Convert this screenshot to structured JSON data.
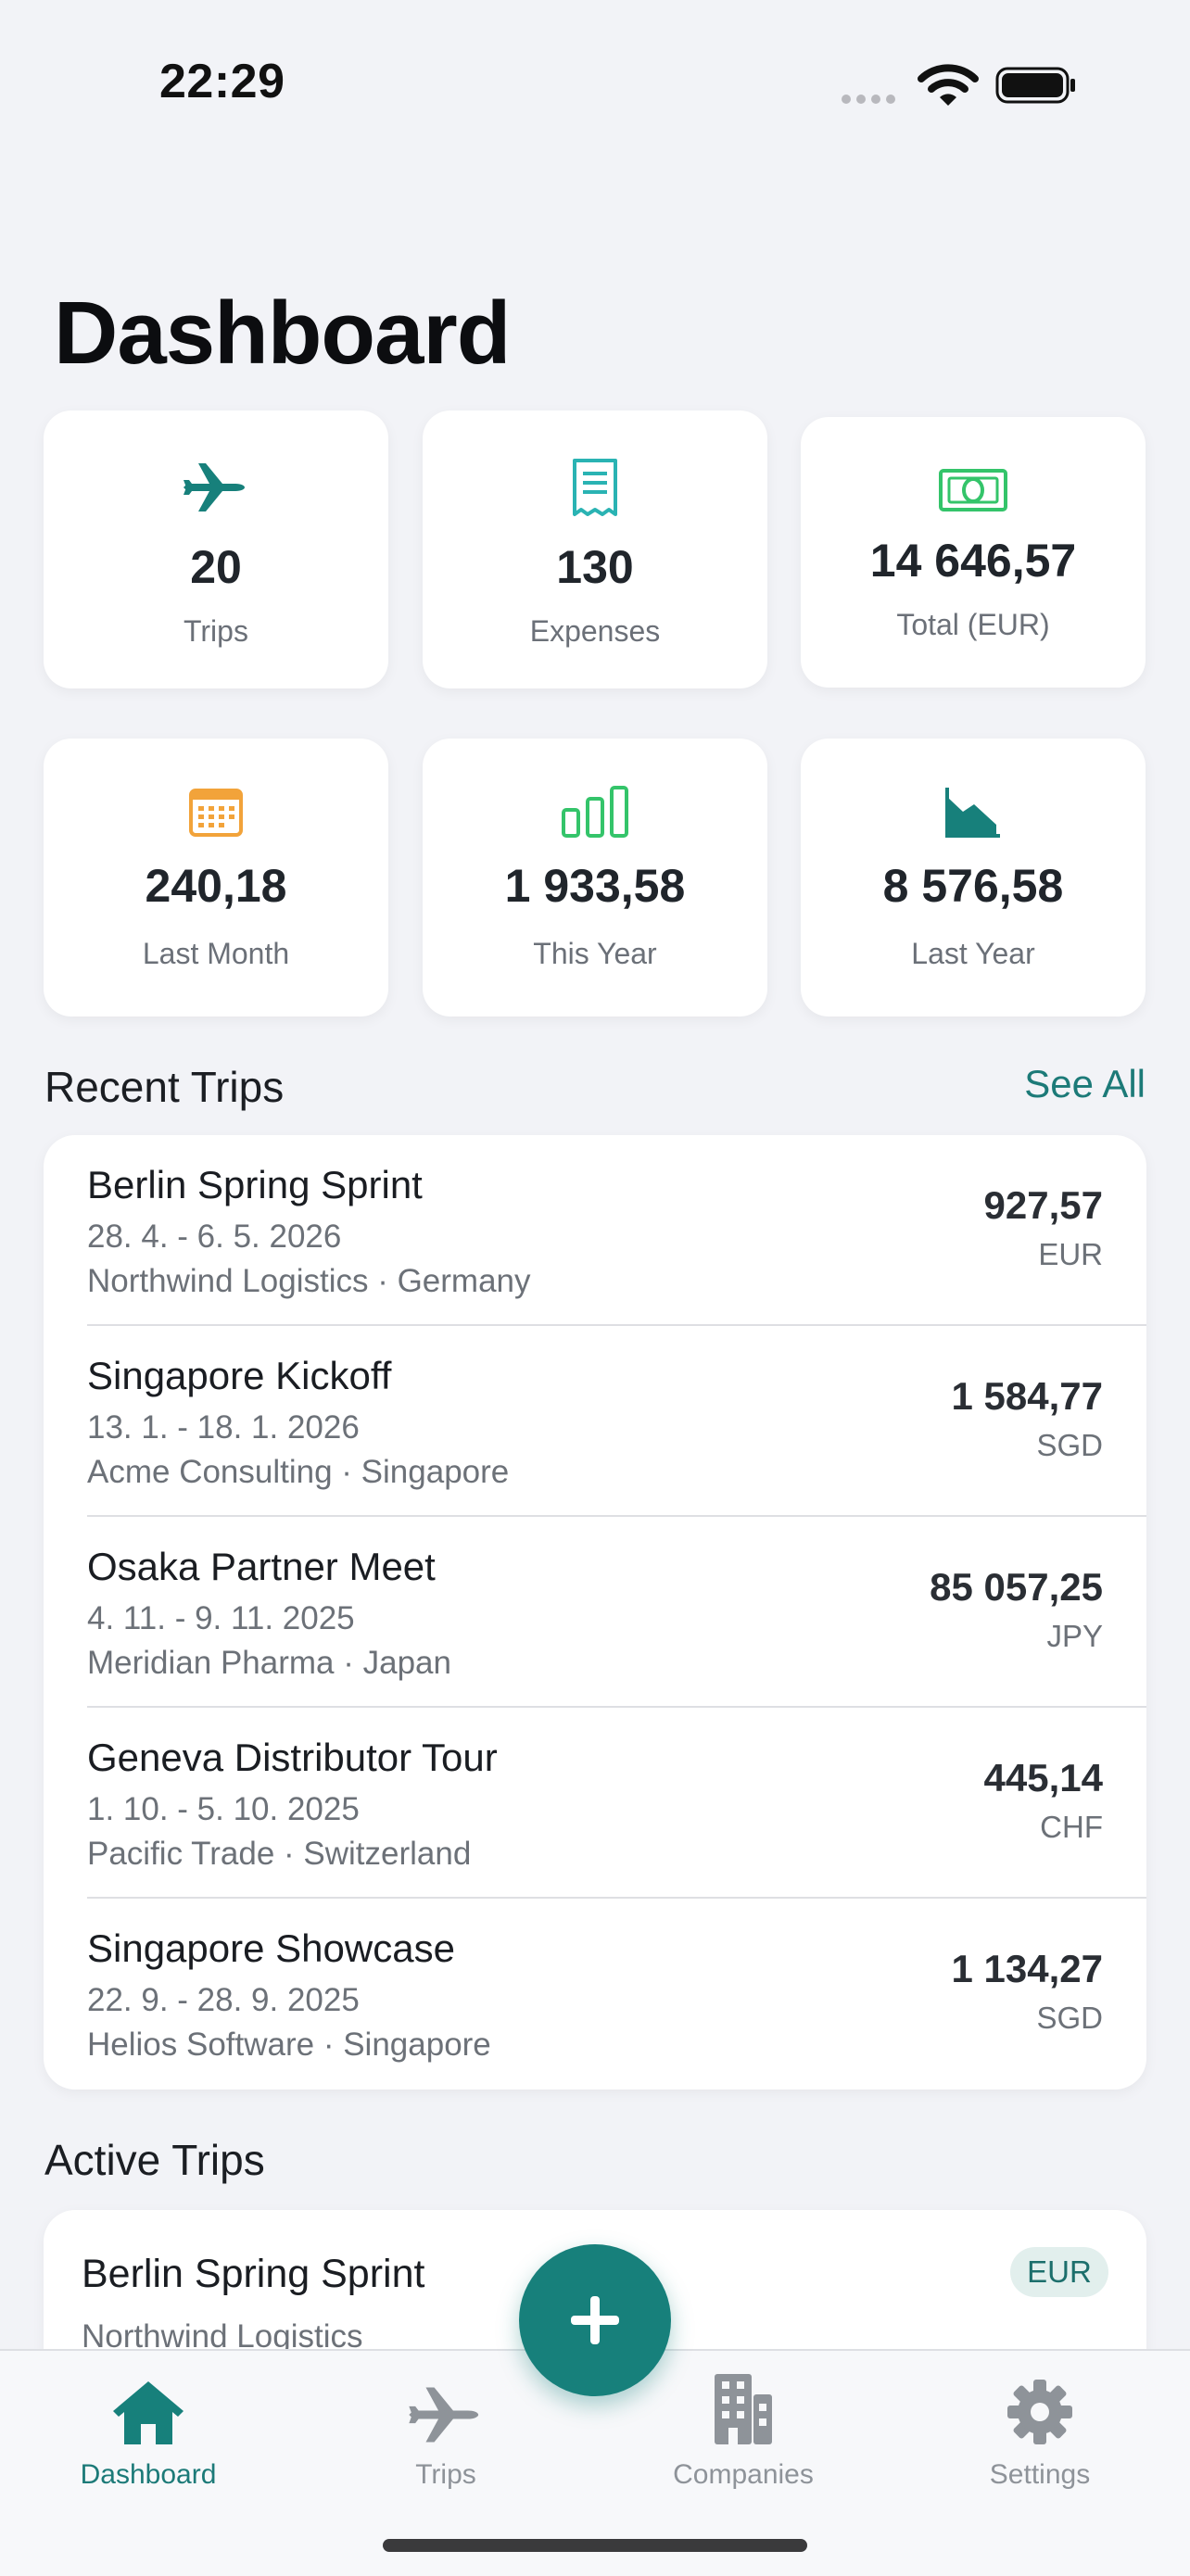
{
  "status_bar": {
    "time": "22:29"
  },
  "page_title": "Dashboard",
  "stats": [
    {
      "icon": "airplane-icon",
      "value": "20",
      "label": "Trips",
      "color": "#17807b"
    },
    {
      "icon": "receipt-icon",
      "value": "130",
      "label": "Expenses",
      "color": "#2ab3b3"
    },
    {
      "icon": "banknote-icon",
      "value": "14 646,57",
      "label": "Total (EUR)",
      "color": "#34c46a"
    },
    {
      "icon": "calendar-icon",
      "value": "240,18",
      "label": "Last Month",
      "color": "#f2a33a"
    },
    {
      "icon": "bar-chart-icon",
      "value": "1 933,58",
      "label": "This Year",
      "color": "#34c46a"
    },
    {
      "icon": "trend-down-chart-icon",
      "value": "8 576,58",
      "label": "Last Year",
      "color": "#17807b"
    }
  ],
  "recent_trips": {
    "title": "Recent Trips",
    "see_all": "See All",
    "items": [
      {
        "name": "Berlin Spring Sprint",
        "dates": "28. 4. - 6. 5. 2026",
        "meta": "Northwind Logistics · Germany",
        "amount": "927,57",
        "currency": "EUR"
      },
      {
        "name": "Singapore Kickoff",
        "dates": "13. 1. - 18. 1. 2026",
        "meta": "Acme Consulting · Singapore",
        "amount": "1 584,77",
        "currency": "SGD"
      },
      {
        "name": "Osaka Partner Meet",
        "dates": "4. 11. - 9. 11. 2025",
        "meta": "Meridian Pharma · Japan",
        "amount": "85 057,25",
        "currency": "JPY"
      },
      {
        "name": "Geneva Distributor Tour",
        "dates": "1. 10. - 5. 10. 2025",
        "meta": "Pacific Trade · Switzerland",
        "amount": "445,14",
        "currency": "CHF"
      },
      {
        "name": "Singapore Showcase",
        "dates": "22. 9. - 28. 9. 2025",
        "meta": "Helios Software · Singapore",
        "amount": "1 134,27",
        "currency": "SGD"
      }
    ]
  },
  "active_trips": {
    "title": "Active Trips",
    "items": [
      {
        "name": "Berlin Spring Sprint",
        "company": "Northwind Logistics",
        "currency": "EUR"
      }
    ]
  },
  "tabs": [
    {
      "label": "Dashboard",
      "icon": "house-icon",
      "active": true
    },
    {
      "label": "Trips",
      "icon": "airplane-icon",
      "active": false
    },
    {
      "label": "Companies",
      "icon": "building-icon",
      "active": false
    },
    {
      "label": "Settings",
      "icon": "gear-icon",
      "active": false
    }
  ],
  "colors": {
    "accent": "#17807b",
    "background": "#f2f3f7",
    "inactive": "#8e9399"
  }
}
